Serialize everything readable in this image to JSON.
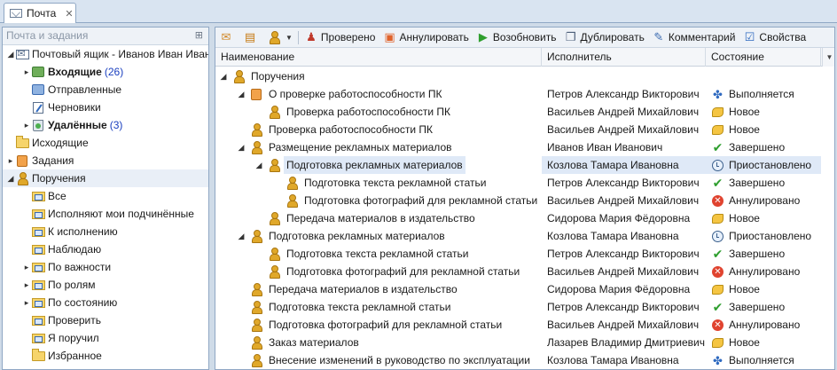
{
  "tab": {
    "title": "Почта",
    "close": "✕"
  },
  "left_panel": {
    "header": "Почта и задания",
    "pin": "⊞",
    "items": [
      {
        "label": "Почтовый ящик - Иванов Иван Иванович",
        "level": 0,
        "expand": "◢",
        "icon": "mailbox-icon",
        "bold": false
      },
      {
        "label": "Входящие",
        "count": "(26)",
        "level": 1,
        "expand": "▸",
        "icon": "inbox-icon",
        "bold": true
      },
      {
        "label": "Отправленные",
        "level": 1,
        "expand": "",
        "icon": "sent-icon",
        "bold": false
      },
      {
        "label": "Черновики",
        "level": 1,
        "expand": "",
        "icon": "draft-icon",
        "bold": false
      },
      {
        "label": "Удалённые",
        "count": "(3)",
        "level": 1,
        "expand": "▸",
        "icon": "trash-icon",
        "bold": true
      },
      {
        "label": "Исходящие",
        "level": 0,
        "expand": "",
        "icon": "folder-icon",
        "bold": false
      },
      {
        "label": "Задания",
        "level": 0,
        "expand": "▸",
        "icon": "tasks-icon",
        "bold": false
      },
      {
        "label": "Поручения",
        "level": 0,
        "expand": "◢",
        "icon": "person-icon",
        "bold": false,
        "selected": true
      },
      {
        "label": "Все",
        "level": 1,
        "expand": "",
        "icon": "search-folder-icon",
        "bold": false
      },
      {
        "label": "Исполняют мои подчинённые",
        "level": 1,
        "expand": "",
        "icon": "search-folder-icon",
        "bold": false
      },
      {
        "label": "К исполнению",
        "level": 1,
        "expand": "",
        "icon": "search-folder-icon",
        "bold": false
      },
      {
        "label": "Наблюдаю",
        "level": 1,
        "expand": "",
        "icon": "search-folder-icon",
        "bold": false
      },
      {
        "label": "По важности",
        "level": 1,
        "expand": "▸",
        "icon": "search-folder-icon",
        "bold": false
      },
      {
        "label": "По ролям",
        "level": 1,
        "expand": "▸",
        "icon": "search-folder-icon",
        "bold": false
      },
      {
        "label": "По состоянию",
        "level": 1,
        "expand": "▸",
        "icon": "search-folder-icon",
        "bold": false
      },
      {
        "label": "Проверить",
        "level": 1,
        "expand": "",
        "icon": "search-folder-icon",
        "bold": false
      },
      {
        "label": "Я поручил",
        "level": 1,
        "expand": "",
        "icon": "search-folder-icon",
        "bold": false
      },
      {
        "label": "Избранное",
        "level": 1,
        "expand": "",
        "icon": "folder-icon",
        "bold": false
      }
    ]
  },
  "toolbar": {
    "checked_label": "Проверено",
    "annul_label": "Аннулировать",
    "resume_label": "Возобновить",
    "duplicate_label": "Дублировать",
    "comment_label": "Комментарий",
    "properties_label": "Свойства"
  },
  "grid": {
    "columns": [
      "Наименование",
      "Исполнитель",
      "Состояние"
    ],
    "rows": [
      {
        "name": "Поручения",
        "level": 0,
        "expand": "◢",
        "icon": "person-icon",
        "executor": "",
        "state": "",
        "state_icon": ""
      },
      {
        "name": "О проверке работоспособности ПК",
        "level": 1,
        "expand": "◢",
        "icon": "task-group-icon",
        "executor": "Петров Александр Викторович",
        "state": "Выполняется",
        "state_icon": "running"
      },
      {
        "name": "Проверка работоспособности ПК",
        "level": 2,
        "expand": "",
        "icon": "person-icon",
        "executor": "Васильев Андрей Михайлович",
        "state": "Новое",
        "state_icon": "new"
      },
      {
        "name": "Проверка работоспособности ПК",
        "level": 1,
        "expand": "",
        "icon": "person-icon",
        "executor": "Васильев Андрей Михайлович",
        "state": "Новое",
        "state_icon": "new"
      },
      {
        "name": "Размещение рекламных материалов",
        "level": 1,
        "expand": "◢",
        "icon": "person-icon",
        "executor": "Иванов Иван Иванович",
        "state": "Завершено",
        "state_icon": "done"
      },
      {
        "name": "Подготовка рекламных материалов",
        "level": 2,
        "expand": "◢",
        "icon": "person-icon",
        "executor": "Козлова Тамара Ивановна",
        "state": "Приостановлено",
        "state_icon": "paused",
        "selected": true
      },
      {
        "name": "Подготовка текста рекламной статьи",
        "level": 3,
        "expand": "",
        "icon": "person-icon",
        "executor": "Петров Александр Викторович",
        "state": "Завершено",
        "state_icon": "done"
      },
      {
        "name": "Подготовка фотографий для рекламной статьи",
        "level": 3,
        "expand": "",
        "icon": "person-icon",
        "executor": "Васильев Андрей Михайлович",
        "state": "Аннулировано",
        "state_icon": "cancelled"
      },
      {
        "name": "Передача материалов в издательство",
        "level": 2,
        "expand": "",
        "icon": "person-icon",
        "executor": "Сидорова Мария Фёдоровна",
        "state": "Новое",
        "state_icon": "new"
      },
      {
        "name": "Подготовка рекламных материалов",
        "level": 1,
        "expand": "◢",
        "icon": "person-icon",
        "executor": "Козлова Тамара Ивановна",
        "state": "Приостановлено",
        "state_icon": "paused"
      },
      {
        "name": "Подготовка текста рекламной статьи",
        "level": 2,
        "expand": "",
        "icon": "person-icon",
        "executor": "Петров Александр Викторович",
        "state": "Завершено",
        "state_icon": "done"
      },
      {
        "name": "Подготовка фотографий для рекламной статьи",
        "level": 2,
        "expand": "",
        "icon": "person-icon",
        "executor": "Васильев Андрей Михайлович",
        "state": "Аннулировано",
        "state_icon": "cancelled"
      },
      {
        "name": "Передача материалов в издательство",
        "level": 1,
        "expand": "",
        "icon": "person-icon",
        "executor": "Сидорова Мария Фёдоровна",
        "state": "Новое",
        "state_icon": "new"
      },
      {
        "name": "Подготовка текста рекламной статьи",
        "level": 1,
        "expand": "",
        "icon": "person-icon",
        "executor": "Петров Александр Викторович",
        "state": "Завершено",
        "state_icon": "done"
      },
      {
        "name": "Подготовка фотографий для рекламной статьи",
        "level": 1,
        "expand": "",
        "icon": "person-icon",
        "executor": "Васильев Андрей Михайлович",
        "state": "Аннулировано",
        "state_icon": "cancelled"
      },
      {
        "name": "Заказ материалов",
        "level": 1,
        "expand": "",
        "icon": "person-icon",
        "executor": "Лазарев Владимир Дмитриевич",
        "state": "Новое",
        "state_icon": "new"
      },
      {
        "name": "Внесение изменений в руководство по эксплуатации",
        "level": 1,
        "expand": "",
        "icon": "person-icon",
        "executor": "Козлова Тамара Ивановна",
        "state": "Выполняется",
        "state_icon": "running"
      }
    ]
  }
}
